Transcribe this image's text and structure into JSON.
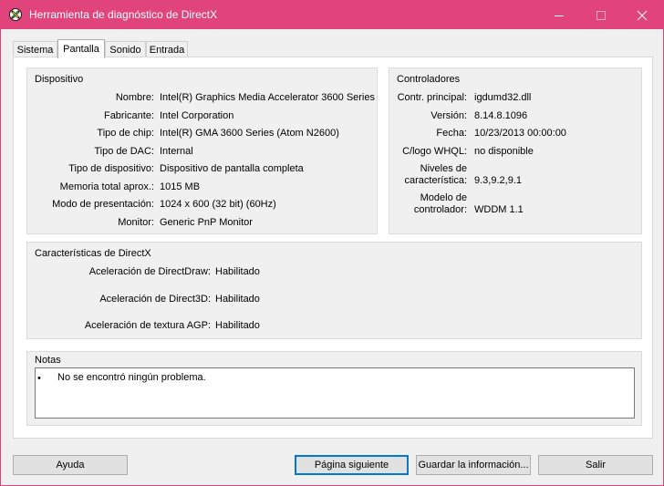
{
  "window": {
    "title": "Herramienta de diagnóstico de DirectX",
    "accent_color": "#e0447a"
  },
  "tabs": [
    {
      "label": "Sistema"
    },
    {
      "label": "Pantalla",
      "active": true
    },
    {
      "label": "Sonido"
    },
    {
      "label": "Entrada"
    }
  ],
  "device": {
    "title": "Dispositivo",
    "rows": [
      {
        "label": "Nombre:",
        "value": "Intel(R) Graphics Media Accelerator 3600 Series"
      },
      {
        "label": "Fabricante:",
        "value": "Intel Corporation"
      },
      {
        "label": "Tipo de chip:",
        "value": "Intel(R) GMA 3600 Series (Atom N2600)"
      },
      {
        "label": "Tipo de DAC:",
        "value": "Internal"
      },
      {
        "label": "Tipo de dispositivo:",
        "value": "Dispositivo de pantalla completa"
      },
      {
        "label": "Memoria total aprox.:",
        "value": "1015 MB"
      },
      {
        "label": "Modo de presentación:",
        "value": "1024 x 600 (32 bit) (60Hz)"
      },
      {
        "label": "Monitor:",
        "value": "Generic PnP Monitor"
      }
    ]
  },
  "drivers": {
    "title": "Controladores",
    "rows": [
      {
        "label": "Contr. principal:",
        "value": "igdumd32.dll"
      },
      {
        "label": "Versión:",
        "value": "8.14.8.1096"
      },
      {
        "label": "Fecha:",
        "value": "10/23/2013 00:00:00"
      },
      {
        "label": "C/logo WHQL:",
        "value": "no disponible"
      }
    ],
    "feature_levels": {
      "label_line1": "Niveles de",
      "label_line2": "característica:",
      "value": "9.3,9.2,9.1"
    },
    "driver_model": {
      "label_line1": "Modelo de",
      "label_line2": "controlador:",
      "value": "WDDM 1.1"
    }
  },
  "directx": {
    "title": "Características de DirectX",
    "rows": [
      {
        "label": "Aceleración de DirectDraw:",
        "value": "Habilitado"
      },
      {
        "label": "Aceleración de Direct3D:",
        "value": "Habilitado"
      },
      {
        "label": "Aceleración de textura AGP:",
        "value": "Habilitado"
      }
    ]
  },
  "notes": {
    "title": "Notas",
    "bullet": "•",
    "text": "No se encontró ningún problema."
  },
  "buttons": {
    "help": "Ayuda",
    "next_page": "Página siguiente",
    "save_info": "Guardar la información...",
    "exit": "Salir"
  }
}
